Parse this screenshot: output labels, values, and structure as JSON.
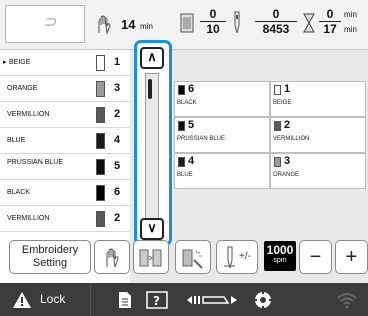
{
  "header": {
    "preview_glyph": "⊃",
    "time_value": "14",
    "time_unit": "min",
    "color_index": "0",
    "color_total": "10",
    "stitch_done": "0",
    "stitch_total": "8453",
    "elapsed": "0",
    "remaining": "17",
    "remaining_unit": "min"
  },
  "thread_list": [
    {
      "name": "BEIGE",
      "count": "1",
      "color": "#ffffff",
      "selected": true
    },
    {
      "name": "ORANGE",
      "count": "3",
      "color": "#9a9a9a"
    },
    {
      "name": "VERMILLION",
      "count": "2",
      "color": "#5a5a5a"
    },
    {
      "name": "BLUE",
      "count": "4",
      "color": "#1b1b1b"
    },
    {
      "name": "PRUSSIAN BLUE",
      "count": "5",
      "color": "#0e0e0e"
    },
    {
      "name": "BLACK",
      "count": "6",
      "color": "#000000"
    },
    {
      "name": "VERMILLION",
      "count": "2",
      "color": "#5a5a5a"
    }
  ],
  "scroll": {
    "up": "∧",
    "down": "∨"
  },
  "thread_grid": [
    {
      "num": "6",
      "label": "BLACK",
      "color": "#000000"
    },
    {
      "num": "1",
      "label": "BEIGE",
      "color": "#ffffff"
    },
    {
      "num": "5",
      "label": "PRUSSIAN BLUE",
      "color": "#0e0e0e"
    },
    {
      "num": "2",
      "label": "VERMILLION",
      "color": "#5a5a5a"
    },
    {
      "num": "4",
      "label": "BLUE",
      "color": "#1b1b1b"
    },
    {
      "num": "3",
      "label": "ORANGE",
      "color": "#9a9a9a"
    }
  ],
  "controls": {
    "embroidery_line1": "Embroidery",
    "embroidery_line2": "Setting",
    "tension_label": "+/-",
    "speed_value": "1000",
    "speed_unit": "spm",
    "minus": "−",
    "plus": "+"
  },
  "bottom_bar": {
    "lock_label": "Lock"
  },
  "colors": {
    "accent": "#1a8fe0",
    "bar": "#3b3b3b",
    "warning": "#ffffff"
  }
}
